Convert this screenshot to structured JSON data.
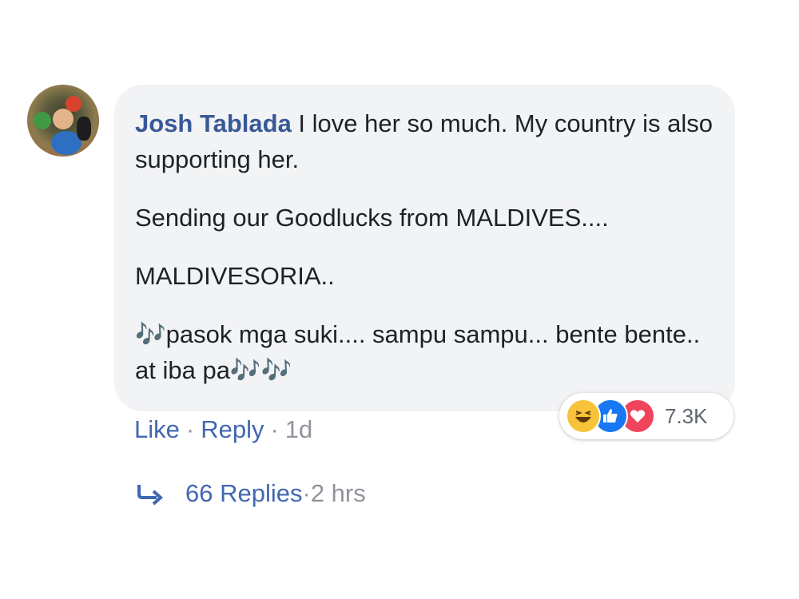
{
  "comment": {
    "author": "Josh Tablada",
    "paragraphs": [
      " I love her so much. My country is also supporting her.",
      "Sending our Goodlucks from MALDIVES....",
      "MALDIVESORIA..",
      "🎶pasok mga suki.... sampu sampu... bente bente.. at iba pa🎶🎶"
    ]
  },
  "reactions": {
    "icons": [
      "haha-icon",
      "like-icon",
      "love-icon"
    ],
    "count": "7.3K"
  },
  "actions": {
    "like": "Like",
    "reply": "Reply",
    "separator": "·",
    "time": "1d"
  },
  "replies": {
    "label": "66 Replies",
    "separator": " · ",
    "time": "2 hrs"
  },
  "colors": {
    "bubble": "#f2f3f5",
    "author": "#385898",
    "link": "#4267b2",
    "muted": "#90949c"
  }
}
